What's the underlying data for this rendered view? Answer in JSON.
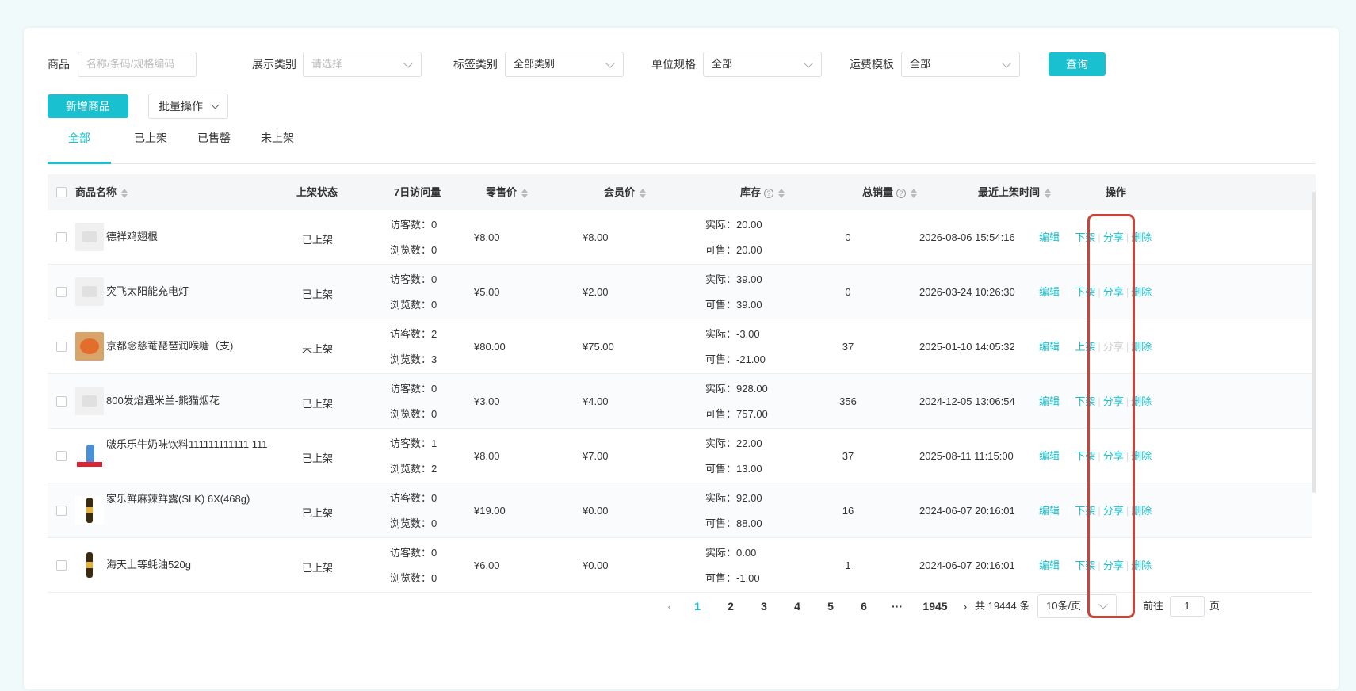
{
  "filters": {
    "product_label": "商品",
    "product_placeholder": "名称/条码/规格编码",
    "display_category_label": "展示类别",
    "display_category_placeholder": "请选择",
    "tag_category_label": "标签类别",
    "tag_category_value": "全部类别",
    "unit_spec_label": "单位规格",
    "unit_spec_value": "全部",
    "shipping_template_label": "运费模板",
    "shipping_template_value": "全部",
    "query_button": "查询"
  },
  "actions": {
    "add_product": "新增商品",
    "batch_ops": "批量操作"
  },
  "tabs": [
    {
      "label": "全部",
      "active": true
    },
    {
      "label": "已上架",
      "active": false
    },
    {
      "label": "已售罄",
      "active": false
    },
    {
      "label": "未上架",
      "active": false
    }
  ],
  "columns": {
    "name": "商品名称",
    "status": "上架状态",
    "visits7d": "7日访问量",
    "retail_price": "零售价",
    "member_price": "会员价",
    "stock": "库存",
    "total_sales": "总销量",
    "last_listed": "最近上架时间",
    "ops": "操作"
  },
  "row_labels": {
    "visitors": "访客数：",
    "views": "浏览数：",
    "actual": "实际：",
    "sellable": "可售："
  },
  "rows": [
    {
      "name": "德祥鸡翅根",
      "status": "已上架",
      "visitors": "0",
      "views": "0",
      "retail": "¥8.00",
      "member": "¥8.00",
      "actual": "20.00",
      "sellable": "20.00",
      "sales": "0",
      "time": "2026-08-06 15:54:16",
      "toggle": "下架",
      "share_disabled": false,
      "thumb": "placeholder"
    },
    {
      "name": "突飞太阳能充电灯",
      "status": "已上架",
      "visitors": "0",
      "views": "0",
      "retail": "¥5.00",
      "member": "¥2.00",
      "actual": "39.00",
      "sellable": "39.00",
      "sales": "0",
      "time": "2026-03-24 10:26:30",
      "toggle": "下架",
      "share_disabled": false,
      "thumb": "placeholder"
    },
    {
      "name": "京都念慈菴琵琶润喉糖（支)",
      "status": "未上架",
      "visitors": "2",
      "views": "3",
      "retail": "¥80.00",
      "member": "¥75.00",
      "actual": "-3.00",
      "sellable": "-21.00",
      "sales": "37",
      "time": "2025-01-10 14:05:32",
      "toggle": "上架",
      "share_disabled": true,
      "thumb": "candy"
    },
    {
      "name": "800发焰遇米兰-熊猫烟花",
      "status": "已上架",
      "visitors": "0",
      "views": "0",
      "retail": "¥3.00",
      "member": "¥4.00",
      "actual": "928.00",
      "sellable": "757.00",
      "sales": "356",
      "time": "2024-12-05 13:06:54",
      "toggle": "下架",
      "share_disabled": false,
      "thumb": "placeholder"
    },
    {
      "name": "啵乐乐牛奶味饮料111111111111 111",
      "status": "已上架",
      "visitors": "1",
      "views": "2",
      "retail": "¥8.00",
      "member": "¥7.00",
      "actual": "22.00",
      "sellable": "13.00",
      "sales": "37",
      "time": "2025-08-11 11:15:00",
      "toggle": "下架",
      "share_disabled": false,
      "thumb": "drink"
    },
    {
      "name": "家乐鲜麻辣鲜露(SLK) 6X(468g)",
      "status": "已上架",
      "visitors": "0",
      "views": "0",
      "retail": "¥19.00",
      "member": "¥0.00",
      "actual": "92.00",
      "sellable": "88.00",
      "sales": "16",
      "time": "2024-06-07 20:16:01",
      "toggle": "下架",
      "share_disabled": false,
      "thumb": "bottle"
    },
    {
      "name": "海天上等蚝油520g",
      "status": "已上架",
      "visitors": "0",
      "views": "0",
      "retail": "¥6.00",
      "member": "¥0.00",
      "actual": "0.00",
      "sellable": "-1.00",
      "sales": "1",
      "time": "2024-06-07 20:16:01",
      "toggle": "下架",
      "share_disabled": false,
      "thumb": "bottle"
    }
  ],
  "row_ops": {
    "edit": "编辑",
    "share": "分享",
    "delete": "删除"
  },
  "pagination": {
    "pages": [
      "1",
      "2",
      "3",
      "4",
      "5",
      "6"
    ],
    "ellipsis": "···",
    "last": "1945",
    "total_text": "共 19444 条",
    "page_size": "10条/页",
    "goto_prefix": "前往",
    "goto_value": "1",
    "goto_suffix": "页"
  },
  "colors": {
    "primary": "#19c1d0",
    "highlight_border": "#c9453b"
  }
}
